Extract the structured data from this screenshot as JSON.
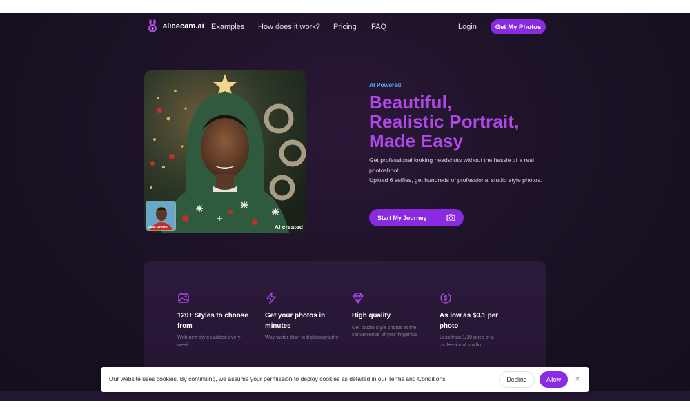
{
  "brand": {
    "name": "alicecam.ai",
    "accent": "#8a2be2",
    "heading_color": "#b048e8"
  },
  "nav": {
    "links": [
      "Examples",
      "How does it work?",
      "Pricing",
      "FAQ"
    ],
    "login": "Login",
    "cta": "Get My Photos"
  },
  "hero": {
    "tag": "AI Powered",
    "headline": [
      "Beautiful,",
      "Realistic Portrait,",
      "Made Easy"
    ],
    "description": [
      "Get professional looking headshots without the hassle of a real photoshoot.",
      "Upload 6 selfies, get hundreds of professional studio style photos."
    ],
    "cta": "Start My Journey",
    "cta_icon": "camera-icon",
    "image_label": "AI created",
    "thumb_label": "Real Photo"
  },
  "features": [
    {
      "icon": "image-icon",
      "title": "120+ Styles to choose from",
      "text": "With new styles added every week"
    },
    {
      "icon": "lightning-icon",
      "title": "Get your photos in minutes",
      "text": "Way faster than real photographer"
    },
    {
      "icon": "diamond-icon",
      "title": "High quality",
      "text": "Get studio style photos at the convenience of your fingertips"
    },
    {
      "icon": "dollar-coin-icon",
      "title": "As low as $0.1 per photo",
      "text": "Less than 1/10 price of a professional studio"
    }
  ],
  "cookie": {
    "text": "Our website uses cookies. By continuing, we assume your permission to deploy cookies as detailed in our",
    "link": "Terms and Conditions.",
    "decline": "Decline",
    "allow": "Allow",
    "close": "×"
  }
}
